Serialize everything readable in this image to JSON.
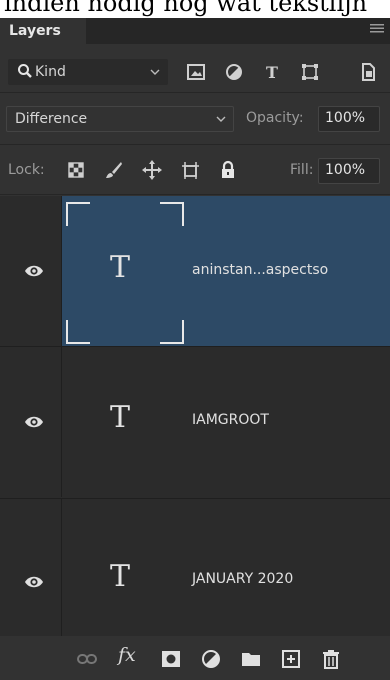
{
  "clip_text": "indien nodig nog wat tekstlijn",
  "panel": {
    "tab_label": "Layers",
    "menu_icon": "panel-menu-icon"
  },
  "filter": {
    "kind_label": "Kind",
    "icons": [
      "image-filter-icon",
      "adjustment-filter-icon",
      "type-filter-icon",
      "shape-filter-icon",
      "smart-object-filter-icon"
    ]
  },
  "blend": {
    "mode": "Difference",
    "opacity_label": "Opacity:",
    "opacity_value": "100%"
  },
  "lock": {
    "label": "Lock:",
    "icons": [
      "lock-transparent-pixels-icon",
      "lock-image-pixels-icon",
      "lock-position-icon",
      "lock-artboard-icon",
      "lock-all-icon"
    ],
    "fill_label": "Fill:",
    "fill_value": "100%"
  },
  "layers": [
    {
      "name": "aninstan...aspectso",
      "type_glyph": "T",
      "selected": true
    },
    {
      "name": "IAMGROOT",
      "type_glyph": "T",
      "selected": false
    },
    {
      "name": "JANUARY 2020",
      "type_glyph": "T",
      "selected": false
    }
  ],
  "footer_icons": [
    "link-layers-icon",
    "fx-icon",
    "layer-mask-icon",
    "adjustment-layer-icon",
    "folder-icon",
    "new-layer-icon",
    "trash-icon"
  ],
  "footer": {
    "fx_label": "fx"
  },
  "colors": {
    "panel_bg": "#323232",
    "selected_layer": "#2d4a66",
    "layer_bg": "#2b2b2b"
  }
}
